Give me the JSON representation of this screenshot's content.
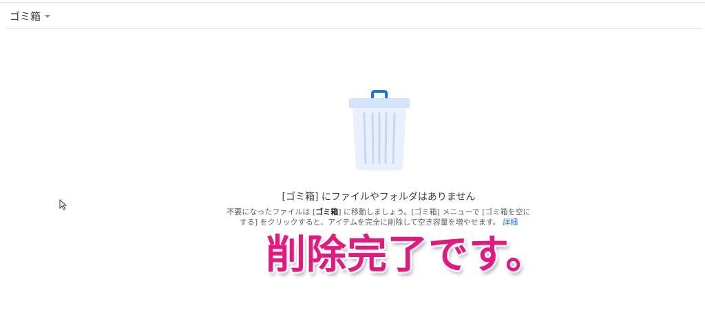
{
  "header": {
    "title": "ゴミ箱",
    "dropdown_icon": "caret-down-icon"
  },
  "empty_state": {
    "illustration": "trash-can-icon",
    "title": "[ゴミ箱] にファイルやフォルダはありません",
    "desc_part1": "不要になったファイルは [",
    "desc_bold": "ゴミ箱",
    "desc_part2": "] に移動しましょう。[ゴミ箱] メニューで [ゴミ箱を空にする] をクリックすると、アイテムを完全に削除して空き容量を増やせます。",
    "learn_more": "詳細"
  },
  "overlay": {
    "caption": "削除完了です。"
  },
  "colors": {
    "caption": "#e8177d",
    "link": "#1a73e8",
    "trash_body": "#e8f0fe",
    "trash_handle": "#1a73e8"
  }
}
